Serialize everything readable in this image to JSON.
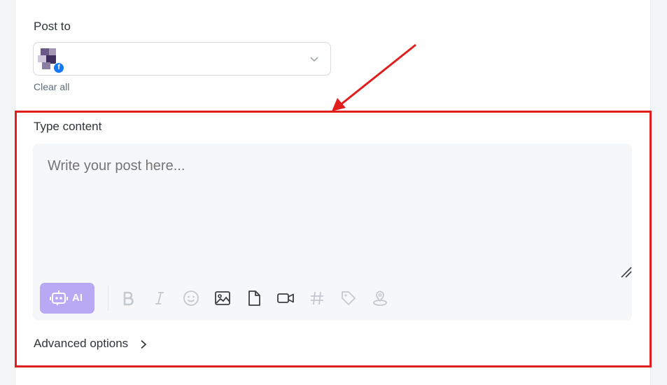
{
  "post_to": {
    "label": "Post to",
    "clear_all": "Clear all",
    "selected_network": "facebook"
  },
  "composer": {
    "label": "Type content",
    "placeholder": "Write your post here...",
    "toolbar": {
      "ai_label": "AI",
      "icons": [
        {
          "name": "bold-icon",
          "enabled": false
        },
        {
          "name": "italic-icon",
          "enabled": false
        },
        {
          "name": "emoji-icon",
          "enabled": false
        },
        {
          "name": "image-icon",
          "enabled": true
        },
        {
          "name": "file-icon",
          "enabled": true
        },
        {
          "name": "video-icon",
          "enabled": true
        },
        {
          "name": "hashtag-icon",
          "enabled": false
        },
        {
          "name": "tag-icon",
          "enabled": false
        },
        {
          "name": "location-icon",
          "enabled": false
        }
      ]
    }
  },
  "advanced_options": {
    "label": "Advanced options"
  },
  "colors": {
    "accent_ai": "#b8a9f5",
    "annotation_red": "#e01e1e",
    "facebook": "#1877f2"
  }
}
